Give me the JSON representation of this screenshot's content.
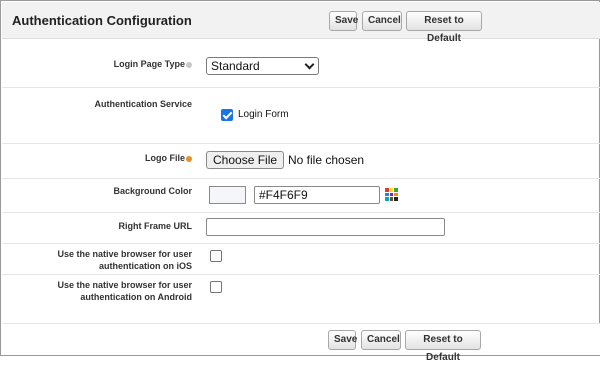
{
  "header": {
    "title": "Authentication Configuration"
  },
  "buttons": {
    "save": "Save",
    "cancel": "Cancel",
    "reset": "Reset to Default"
  },
  "fields": {
    "login_page_type": {
      "label": "Login Page Type",
      "value": "Standard"
    },
    "authentication_service": {
      "label": "Authentication Service",
      "option_label": "Login Form",
      "checked": true
    },
    "logo_file": {
      "label": "Logo File",
      "button": "Choose File",
      "status": "No file chosen"
    },
    "background_color": {
      "label": "Background Color",
      "value": "#F4F6F9"
    },
    "right_frame_url": {
      "label": "Right Frame URL",
      "value": ""
    },
    "native_ios": {
      "label_line1": "Use the native browser for user",
      "label_line2": "authentication on iOS",
      "checked": false
    },
    "native_android": {
      "label_line1": "Use the native browser for user",
      "label_line2": "authentication on Android",
      "checked": false
    }
  },
  "icons": {
    "help": "help-icon",
    "help_orange": "help-icon-orange",
    "color_picker": "color-palette-icon",
    "dropdown": "chevron-down-icon"
  },
  "colors": {
    "header_bg": "#f2f2f2",
    "checkbox_checked": "#1a73e8",
    "swatch": "#F4F6F9",
    "help_orange": "#e8902a"
  }
}
